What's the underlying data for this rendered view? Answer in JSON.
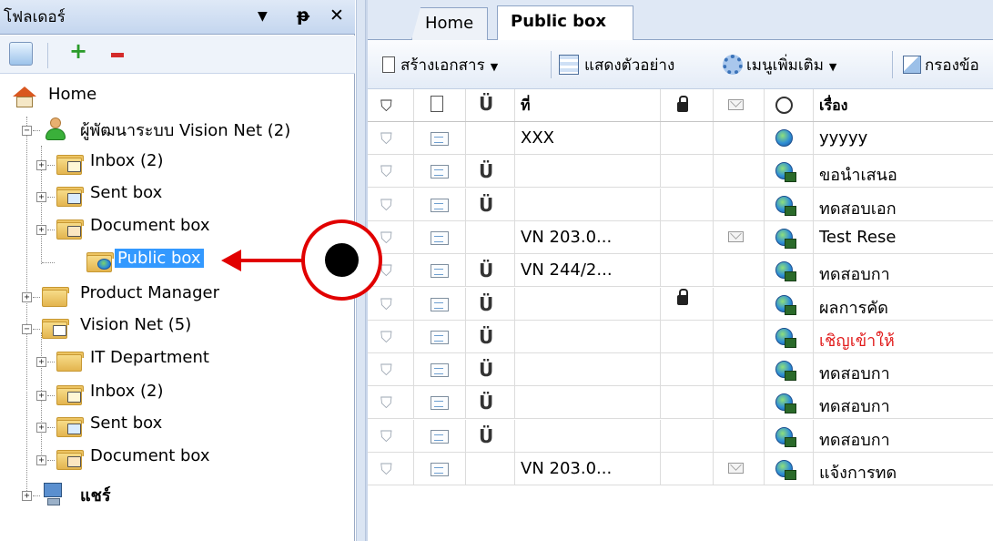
{
  "folder_pane": {
    "title": "โฟลเดอร์",
    "header_buttons": {
      "dropdown": "▼",
      "pin": "ᵽ",
      "close": "✕"
    },
    "toolbar": {
      "refresh_icon": "refresh-icon",
      "add_icon": "plus-icon",
      "remove_icon": "minus-icon"
    },
    "tree": {
      "home": "Home",
      "developer_group": "ผู้พัฒนาระบบ Vision Net (2)",
      "developer_children": [
        "Inbox (2)",
        "Sent box",
        "Document box",
        "Public box"
      ],
      "product_manager": "Product Manager",
      "vision_net": "Vision Net (5)",
      "vision_net_children": [
        "IT Department",
        "Inbox (2)",
        "Sent box",
        "Document box"
      ],
      "share": "แชร์"
    }
  },
  "tabs": [
    {
      "label": "Home",
      "active": false
    },
    {
      "label": "Public box",
      "active": true
    }
  ],
  "toolbar": {
    "create_document": "สร้างเอกสาร",
    "show_preview": "แสดงตัวอย่าง",
    "more_menu": "เมนูเพิ่มเติม",
    "filter": "กรองข้อ"
  },
  "grid": {
    "columns": {
      "flag": "flag-icon",
      "doc": "document-icon",
      "attachment": "paperclip-icon",
      "number": "ที่",
      "lock": "lock-icon",
      "mail": "mail-icon",
      "web": "globe-icon",
      "subject": "เรื่อง"
    },
    "rows": [
      {
        "attach": "",
        "number": "XXX",
        "lock": false,
        "mail": false,
        "globe": "plain",
        "subject": "yyyyy",
        "subject_red": false
      },
      {
        "attach": "Ü",
        "number": "",
        "lock": false,
        "mail": false,
        "globe": "ex",
        "subject": "ขอนำเสนอ",
        "subject_red": false
      },
      {
        "attach": "Ü",
        "number": "",
        "lock": false,
        "mail": false,
        "globe": "ex",
        "subject": "ทดสอบเอก",
        "subject_red": false
      },
      {
        "attach": "",
        "number": "VN 203.0...",
        "lock": false,
        "mail": true,
        "globe": "ex",
        "subject": "Test Rese",
        "subject_red": false
      },
      {
        "attach": "Ü",
        "number": "VN 244/2...",
        "lock": false,
        "mail": false,
        "globe": "ex",
        "subject": "ทดสอบกา",
        "subject_red": false
      },
      {
        "attach": "Ü",
        "number": "",
        "lock": true,
        "mail": false,
        "globe": "ex",
        "subject": "ผลการคัด",
        "subject_red": false
      },
      {
        "attach": "Ü",
        "number": "",
        "lock": false,
        "mail": false,
        "globe": "ex",
        "subject": "เชิญเข้าให้",
        "subject_red": true
      },
      {
        "attach": "Ü",
        "number": "",
        "lock": false,
        "mail": false,
        "globe": "ex",
        "subject": "ทดสอบกา",
        "subject_red": false
      },
      {
        "attach": "Ü",
        "number": "",
        "lock": false,
        "mail": false,
        "globe": "ex",
        "subject": "ทดสอบกา",
        "subject_red": false
      },
      {
        "attach": "Ü",
        "number": "",
        "lock": false,
        "mail": false,
        "globe": "ex",
        "subject": "ทดสอบกา",
        "subject_red": false
      },
      {
        "attach": "",
        "number": "VN 203.0...",
        "lock": false,
        "mail": true,
        "globe": "ex",
        "subject": "แจ้งการทด",
        "subject_red": false
      }
    ]
  },
  "colors": {
    "callout": "#e10000",
    "selection": "#3399ff",
    "red_subject": "#e11d1d"
  }
}
